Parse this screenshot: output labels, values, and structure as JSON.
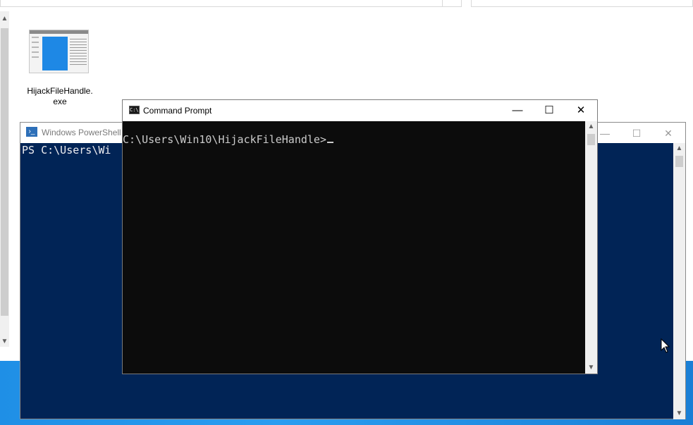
{
  "explorer": {
    "file": {
      "name": "HijackFileHandle.\nexe",
      "label_line1": "HijackFileHandle.",
      "label_line2": "exe"
    }
  },
  "powershell": {
    "title": "Windows PowerShell",
    "prompt_text": "PS C:\\Users\\Wi",
    "controls": {
      "minimize": "—",
      "maximize": "☐",
      "close": "✕"
    }
  },
  "cmd": {
    "title": "Command Prompt",
    "prompt_text": "C:\\Users\\Win10\\HijackFileHandle>",
    "icon_text": "C:\\",
    "controls": {
      "minimize": "—",
      "maximize": "☐",
      "close": "✕"
    }
  },
  "colors": {
    "powershell_bg": "#012456",
    "cmd_bg": "#0c0c0c",
    "desktop_blue": "#1f8fe6"
  }
}
